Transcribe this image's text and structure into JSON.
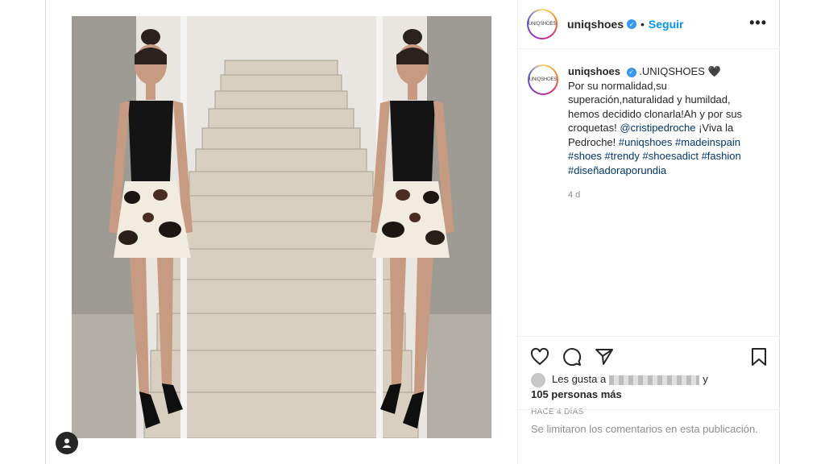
{
  "post": {
    "username": "uniqshoes",
    "follow_label": "Seguir",
    "separator": "•",
    "more_label": "•••",
    "avatar_text": "UNIQSHOES",
    "verified_mark": "✓"
  },
  "caption": {
    "username": "uniqshoes",
    "title": ".UNIQSHOES 🖤",
    "line1": "Por su normalidad,su superación,naturalidad y humildad, hemos decidido clonarla!Ah y por sus croquetas!",
    "mention": "@cristipedroche",
    "line2": "¡Viva la Pedroche!",
    "hashtags": [
      "#uniqshoes",
      "#madeinspain",
      "#shoes",
      "#trendy",
      "#shoesadict",
      "#fashion",
      "#diseñadoraporundia"
    ],
    "time_ago": "4 d"
  },
  "actions": {
    "like_icon": "heart-icon",
    "comment_icon": "comment-icon",
    "share_icon": "share-icon",
    "save_icon": "bookmark-icon"
  },
  "likes": {
    "prefix": "Les gusta a",
    "suffix": "y",
    "others": "105 personas más"
  },
  "posted_label": "HACE 4 DÍAS",
  "comments_disabled": "Se limitaron los comentarios en esta publicación.",
  "colors": {
    "link": "#00376b",
    "follow": "#0095f6",
    "verified": "#3897f0"
  }
}
